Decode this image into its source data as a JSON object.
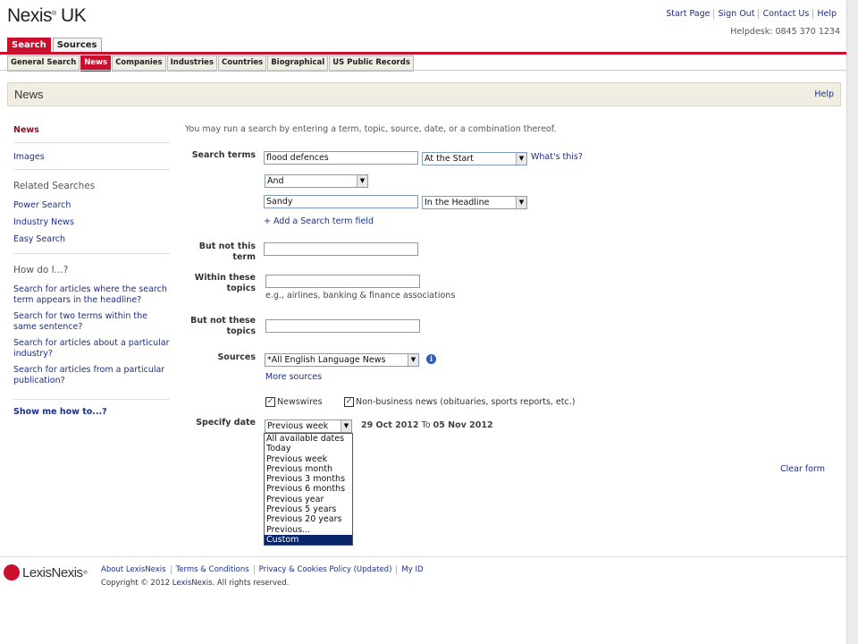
{
  "header": {
    "logo_main": "Nexis",
    "logo_reg": "®",
    "logo_suffix": " UK",
    "links": [
      "Start Page",
      "Sign Out",
      "Contact Us",
      "Help"
    ],
    "helpdesk": "Helpdesk: 0845 370 1234"
  },
  "main_tabs": [
    "Search",
    "Sources"
  ],
  "sub_tabs": [
    "General Search",
    "News",
    "Companies",
    "Industries",
    "Countries",
    "Biographical",
    "US Public Records"
  ],
  "title_bar": {
    "title": "News",
    "help": "Help"
  },
  "sidebar": {
    "current": "News",
    "images": "Images",
    "related_heading": "Related Searches",
    "related": [
      "Power Search",
      "Industry News",
      "Easy Search"
    ],
    "howto_heading": "How do I...?",
    "howto": [
      "Search for articles where the search term appears in the headline?",
      "Search for two terms within the same sentence?",
      "Search for articles about a particular industry?",
      "Search for articles from a particular publication?"
    ],
    "show_me": "Show me how to...?"
  },
  "form": {
    "intro": "You may run a search by entering a term, topic, source, date, or a combination thereof.",
    "search_terms_label": "Search terms",
    "term1": "flood defences",
    "term1_position": "At the Start",
    "whats_this": "What's this?",
    "connector": "And",
    "term2": "Sandy",
    "term2_position": "In the Headline",
    "add_field": "+ Add a Search term field",
    "but_not_term_label": "But not this term",
    "within_topics_label": "Within these topics",
    "topics_hint": "e.g., airlines, banking & finance associations",
    "but_not_topics_label": "But not these topics",
    "sources_label": "Sources",
    "sources_value": "*All English Language News",
    "more_sources": "More sources",
    "newswires": "Newswires",
    "nonbusiness": "Non-business news (obituaries, sports reports, etc.)",
    "date_label": "Specify date",
    "date_value": "Previous week",
    "date_from": "29 Oct 2012",
    "date_to_word": "To",
    "date_to": "05 Nov 2012",
    "date_options": [
      "All available dates",
      "Today",
      "Previous week",
      "Previous month",
      "Previous 3 months",
      "Previous 6 months",
      "Previous year",
      "Previous 5 years",
      "Previous 20 years",
      "Previous...",
      "Custom"
    ],
    "clear_form": "Clear form"
  },
  "footer": {
    "brand": "LexisNexis",
    "brand_reg": "®",
    "links": [
      "About LexisNexis",
      "Terms & Conditions",
      "Privacy & Cookies Policy (Updated)",
      "My ID"
    ],
    "copyright_prefix": "Copyright © 2012 ",
    "copyright_link": "LexisNexis",
    "copyright_suffix": ". All rights reserved."
  }
}
